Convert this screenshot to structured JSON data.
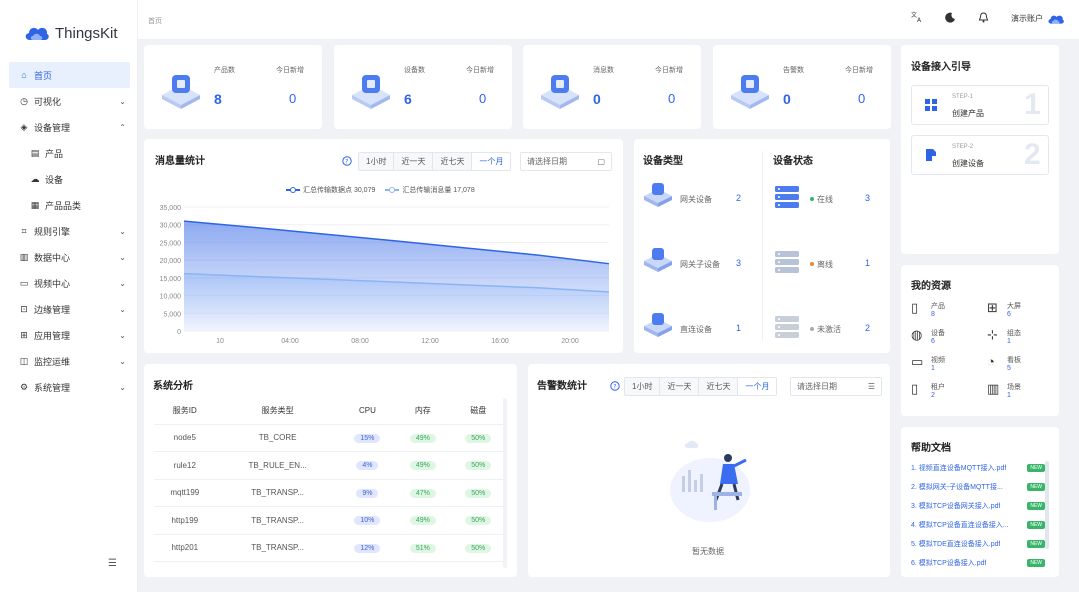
{
  "app": {
    "name": "ThingsKit"
  },
  "sidebar": {
    "items": [
      {
        "label": "首页",
        "icon": "home-icon",
        "glyph": "⌂",
        "active": true,
        "sub": false,
        "chevron": ""
      },
      {
        "label": "可视化",
        "icon": "chart-icon",
        "glyph": "◷",
        "active": false,
        "sub": false,
        "chevron": "⌄"
      },
      {
        "label": "设备管理",
        "icon": "device-icon",
        "glyph": "◈",
        "active": false,
        "sub": false,
        "chevron": "⌃"
      },
      {
        "label": "产品",
        "icon": "product-icon",
        "glyph": "▤",
        "active": false,
        "sub": true,
        "chevron": ""
      },
      {
        "label": "设备",
        "icon": "cloud-device-icon",
        "glyph": "☁",
        "active": false,
        "sub": true,
        "chevron": ""
      },
      {
        "label": "产品品类",
        "icon": "category-icon",
        "glyph": "▦",
        "active": false,
        "sub": true,
        "chevron": ""
      },
      {
        "label": "规则引擎",
        "icon": "rule-icon",
        "glyph": "⌗",
        "active": false,
        "sub": false,
        "chevron": "⌄"
      },
      {
        "label": "数据中心",
        "icon": "data-icon",
        "glyph": "▥",
        "active": false,
        "sub": false,
        "chevron": "⌄"
      },
      {
        "label": "视频中心",
        "icon": "video-icon",
        "glyph": "▭",
        "active": false,
        "sub": false,
        "chevron": "⌄"
      },
      {
        "label": "边缘管理",
        "icon": "edge-icon",
        "glyph": "⊡",
        "active": false,
        "sub": false,
        "chevron": "⌄"
      },
      {
        "label": "应用管理",
        "icon": "app-icon",
        "glyph": "⊞",
        "active": false,
        "sub": false,
        "chevron": "⌄"
      },
      {
        "label": "监控运维",
        "icon": "monitor-icon",
        "glyph": "◫",
        "active": false,
        "sub": false,
        "chevron": "⌄"
      },
      {
        "label": "系统管理",
        "icon": "settings-icon",
        "glyph": "⚙",
        "active": false,
        "sub": false,
        "chevron": "⌄"
      }
    ],
    "collapse_icon": "☰"
  },
  "header": {
    "breadcrumb": "首页",
    "user": "演示账户"
  },
  "stats": [
    {
      "title": "产品数",
      "value": "8",
      "today_label": "今日新增",
      "today": "0",
      "color": "#4c7cf0"
    },
    {
      "title": "设备数",
      "value": "6",
      "today_label": "今日新增",
      "today": "0",
      "color": "#4c7cf0"
    },
    {
      "title": "消息数",
      "value": "0",
      "today_label": "今日新增",
      "today": "0",
      "color": "#4c7cf0"
    },
    {
      "title": "告警数",
      "value": "0",
      "today_label": "今日新增",
      "today": "0",
      "color": "#4c7cf0"
    }
  ],
  "message_stats": {
    "title": "消息量统计",
    "tabs": [
      "1小时",
      "近一天",
      "近七天",
      "一个月"
    ],
    "active_tab": 3,
    "date_placeholder": "请选择日期"
  },
  "chart_data": {
    "type": "area",
    "title": "消息量统计",
    "x": [
      "10",
      "04:00",
      "08:00",
      "12:00",
      "16:00",
      "20:00"
    ],
    "ylim": [
      0,
      35000
    ],
    "yticks": [
      "35,000",
      "30,000",
      "25,000",
      "20,000",
      "15,000",
      "10,000",
      "5,000",
      "0"
    ],
    "series": [
      {
        "name": "汇总传输数据点 30,079",
        "color": "#2f64e6",
        "values": [
          31000,
          29200,
          27300,
          25400,
          23400,
          21400,
          19000
        ]
      },
      {
        "name": "汇总传输消息量 17,078",
        "color": "#8ab4f8",
        "values": [
          16200,
          15400,
          14600,
          13800,
          13000,
          12200,
          11000
        ]
      }
    ],
    "grid": true,
    "legend": "top-center"
  },
  "device_types": {
    "title": "设备类型",
    "items": [
      {
        "label": "网关设备",
        "value": "2"
      },
      {
        "label": "网关子设备",
        "value": "3"
      },
      {
        "label": "直连设备",
        "value": "1"
      }
    ]
  },
  "device_status": {
    "title": "设备状态",
    "items": [
      {
        "label": "在线",
        "value": "3",
        "color": "#39b56a"
      },
      {
        "label": "离线",
        "value": "1",
        "color": "#f0883a"
      },
      {
        "label": "未激活",
        "value": "2",
        "color": "#aaaaaa"
      }
    ]
  },
  "system_analysis": {
    "title": "系统分析",
    "columns": [
      "服务ID",
      "服务类型",
      "CPU",
      "内存",
      "磁盘"
    ],
    "rows": [
      [
        "node5",
        "TB_CORE",
        "15%",
        "49%",
        "50%"
      ],
      [
        "rule12",
        "TB_RULE_EN...",
        "4%",
        "49%",
        "50%"
      ],
      [
        "mqtt199",
        "TB_TRANSP...",
        "9%",
        "47%",
        "50%"
      ],
      [
        "http199",
        "TB_TRANSP...",
        "10%",
        "49%",
        "50%"
      ],
      [
        "http201",
        "TB_TRANSP...",
        "12%",
        "51%",
        "50%"
      ]
    ]
  },
  "alarm_stats": {
    "title": "告警数统计",
    "tabs": [
      "1小时",
      "近一天",
      "近七天",
      "一个月"
    ],
    "active_tab": 3,
    "date_placeholder": "请选择日期",
    "empty_text": "暂无数据"
  },
  "guide": {
    "title": "设备接入引导",
    "steps": [
      {
        "step": "STEP-1",
        "name": "创建产品",
        "num": "1"
      },
      {
        "step": "STEP-2",
        "name": "创建设备",
        "num": "2"
      }
    ]
  },
  "resources": {
    "title": "我的资源",
    "items": [
      {
        "label": "产品",
        "value": "8",
        "icon": "product-res-icon",
        "glyph": "▯"
      },
      {
        "label": "大屏",
        "value": "6",
        "icon": "screen-res-icon",
        "glyph": "⊞"
      },
      {
        "label": "设备",
        "value": "6",
        "icon": "device-res-icon",
        "glyph": "◍"
      },
      {
        "label": "组态",
        "value": "1",
        "icon": "config-res-icon",
        "glyph": "⊹"
      },
      {
        "label": "视频",
        "value": "1",
        "icon": "video-res-icon",
        "glyph": "▭"
      },
      {
        "label": "看板",
        "value": "5",
        "icon": "dashboard-res-icon",
        "glyph": "◔"
      },
      {
        "label": "租户",
        "value": "2",
        "icon": "tenant-res-icon",
        "glyph": "▯"
      },
      {
        "label": "场景",
        "value": "1",
        "icon": "scene-res-icon",
        "glyph": "▥"
      }
    ]
  },
  "help_docs": {
    "title": "帮助文档",
    "badge": "NEW",
    "items": [
      "1. 视频直连设备MQTT接入.pdf",
      "2. 模拟网关-子设备MQTT接...",
      "3. 模拟TCP设备网关接入.pdf",
      "4. 模拟TCP设备直连设备接入...",
      "5. 模拟TDE直连设备接入.pdf",
      "6. 模拟TCP设备接入.pdf"
    ]
  }
}
